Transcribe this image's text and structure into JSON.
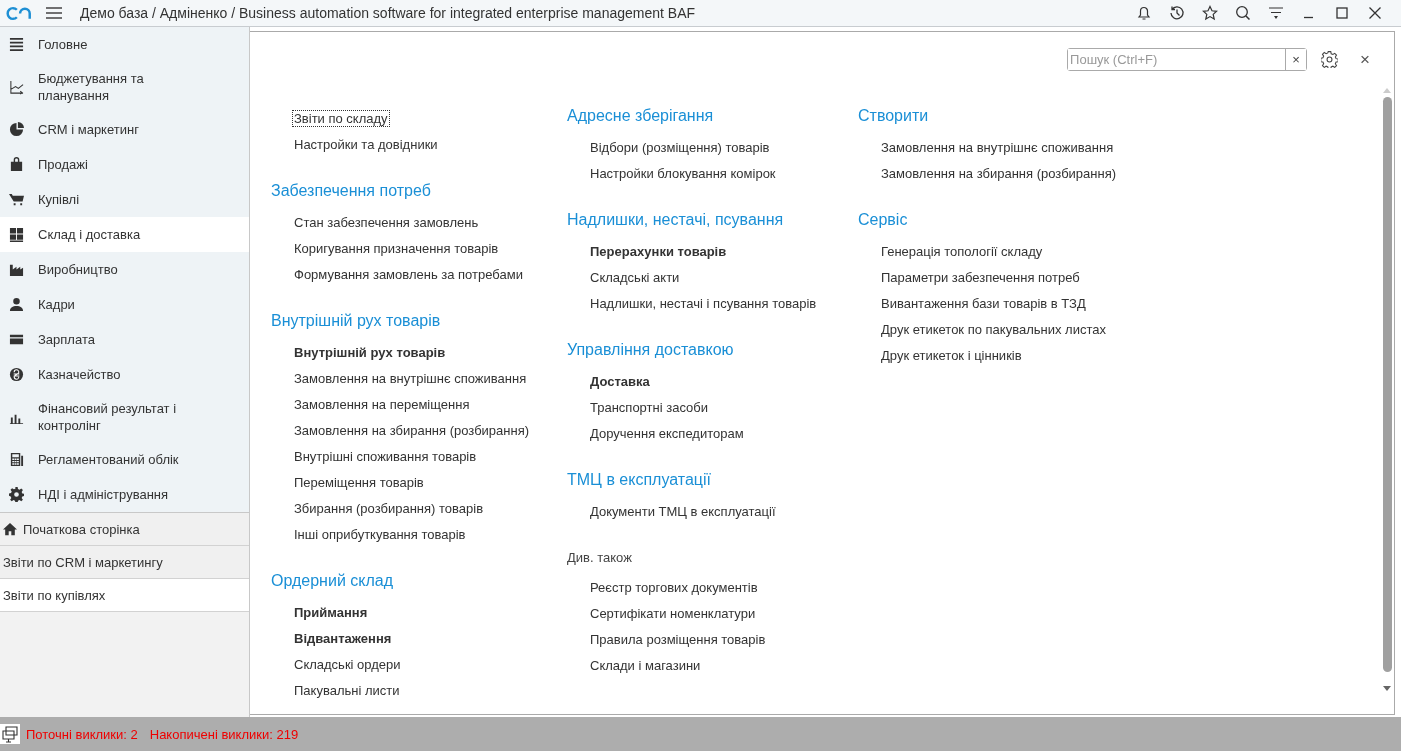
{
  "window": {
    "title": "Демо база / Адміненко / Business automation software for integrated enterprise management BAF"
  },
  "sidebar": {
    "items": [
      {
        "label": "Головне",
        "selected": false
      },
      {
        "label": "Бюджетування та планування",
        "selected": false
      },
      {
        "label": "CRM і маркетинг",
        "selected": false
      },
      {
        "label": "Продажі",
        "selected": false
      },
      {
        "label": "Купівлі",
        "selected": false
      },
      {
        "label": "Склад і доставка",
        "selected": true
      },
      {
        "label": "Виробництво",
        "selected": false
      },
      {
        "label": "Кадри",
        "selected": false
      },
      {
        "label": "Зарплата",
        "selected": false
      },
      {
        "label": "Казначейство",
        "selected": false
      },
      {
        "label": "Фінансовий результат і контролінг",
        "selected": false
      },
      {
        "label": "Регламентований облік",
        "selected": false
      },
      {
        "label": "НДІ і адміністрування",
        "selected": false
      }
    ],
    "open_windows": [
      {
        "label": "Початкова сторінка",
        "kind": "home",
        "selected": false
      },
      {
        "label": "Звіти по CRM і маркетингу",
        "kind": "window",
        "selected": false
      },
      {
        "label": "Звіти по купівлях",
        "kind": "window",
        "selected": true
      }
    ]
  },
  "search": {
    "placeholder": "Пошук (Ctrl+F)",
    "clear": "×"
  },
  "close": "×",
  "columns": [
    {
      "groups": [
        {
          "kind": "plain",
          "items": [
            {
              "text": "Звіти по складу",
              "bold": false,
              "focused": true
            },
            {
              "text": "Настройки та довідники",
              "bold": false,
              "focused": false
            }
          ]
        },
        {
          "kind": "section",
          "title": "Забезпечення потреб",
          "items": [
            {
              "text": "Стан забезпечення замовлень",
              "bold": false,
              "focused": false
            },
            {
              "text": "Коригування призначення товарів",
              "bold": false,
              "focused": false
            },
            {
              "text": "Формування замовлень за потребами",
              "bold": false,
              "focused": false
            }
          ]
        },
        {
          "kind": "section",
          "title": "Внутрішній рух товарів",
          "items": [
            {
              "text": "Внутрішній рух товарів",
              "bold": true,
              "focused": false
            },
            {
              "text": "Замовлення на внутрішнє споживання",
              "bold": false,
              "focused": false
            },
            {
              "text": "Замовлення на переміщення",
              "bold": false,
              "focused": false
            },
            {
              "text": "Замовлення на збирання (розбирання)",
              "bold": false,
              "focused": false
            },
            {
              "text": "Внутрішні споживання товарів",
              "bold": false,
              "focused": false
            },
            {
              "text": "Переміщення товарів",
              "bold": false,
              "focused": false
            },
            {
              "text": "Збирання (розбирання) товарів",
              "bold": false,
              "focused": false
            },
            {
              "text": "Інші оприбуткування товарів",
              "bold": false,
              "focused": false
            }
          ]
        },
        {
          "kind": "section",
          "title": "Ордерний склад",
          "items": [
            {
              "text": "Приймання",
              "bold": true,
              "focused": false
            },
            {
              "text": "Відвантаження",
              "bold": true,
              "focused": false
            },
            {
              "text": "Складські ордери",
              "bold": false,
              "focused": false
            },
            {
              "text": "Пакувальні листи",
              "bold": false,
              "focused": false
            }
          ]
        }
      ]
    },
    {
      "groups": [
        {
          "kind": "section",
          "title": "Адресне зберігання",
          "items": [
            {
              "text": "Відбори (розміщення) товарів",
              "bold": false,
              "focused": false
            },
            {
              "text": "Настройки блокування комірок",
              "bold": false,
              "focused": false
            }
          ]
        },
        {
          "kind": "section",
          "title": "Надлишки, нестачі, псування",
          "items": [
            {
              "text": "Перерахунки товарів",
              "bold": true,
              "focused": false
            },
            {
              "text": "Складські акти",
              "bold": false,
              "focused": false
            },
            {
              "text": "Надлишки, нестачі і псування товарів",
              "bold": false,
              "focused": false
            }
          ]
        },
        {
          "kind": "section",
          "title": "Управління доставкою",
          "items": [
            {
              "text": "Доставка",
              "bold": true,
              "focused": false
            },
            {
              "text": "Транспортні засоби",
              "bold": false,
              "focused": false
            },
            {
              "text": "Доручення експедиторам",
              "bold": false,
              "focused": false
            }
          ]
        },
        {
          "kind": "section",
          "title": "ТМЦ в експлуатації",
          "items": [
            {
              "text": "Документи ТМЦ в експлуатації",
              "bold": false,
              "focused": false
            }
          ]
        },
        {
          "kind": "see_also",
          "title": "Див. також",
          "items": [
            {
              "text": "Реєстр торгових документів",
              "bold": false,
              "focused": false
            },
            {
              "text": "Сертифікати номенклатури",
              "bold": false,
              "focused": false
            },
            {
              "text": "Правила розміщення товарів",
              "bold": false,
              "focused": false
            },
            {
              "text": "Склади і магазини",
              "bold": false,
              "focused": false
            }
          ]
        }
      ]
    },
    {
      "groups": [
        {
          "kind": "section",
          "title": "Створити",
          "items": [
            {
              "text": "Замовлення на внутрішнє споживання",
              "bold": false,
              "focused": false
            },
            {
              "text": "Замовлення на збирання (розбирання)",
              "bold": false,
              "focused": false
            }
          ]
        },
        {
          "kind": "section",
          "title": "Сервіс",
          "items": [
            {
              "text": "Генерація топології складу",
              "bold": false,
              "focused": false
            },
            {
              "text": "Параметри забезпечення потреб",
              "bold": false,
              "focused": false
            },
            {
              "text": "Вивантаження бази товарів в ТЗД",
              "bold": false,
              "focused": false
            },
            {
              "text": "Друк етикеток по пакувальних листах",
              "bold": false,
              "focused": false
            },
            {
              "text": "Друк етикеток і цінників",
              "bold": false,
              "focused": false
            }
          ]
        }
      ]
    }
  ],
  "status_bar": {
    "items": [
      "Поточні виклики: 2",
      "Накопичені виклики: 219"
    ]
  }
}
